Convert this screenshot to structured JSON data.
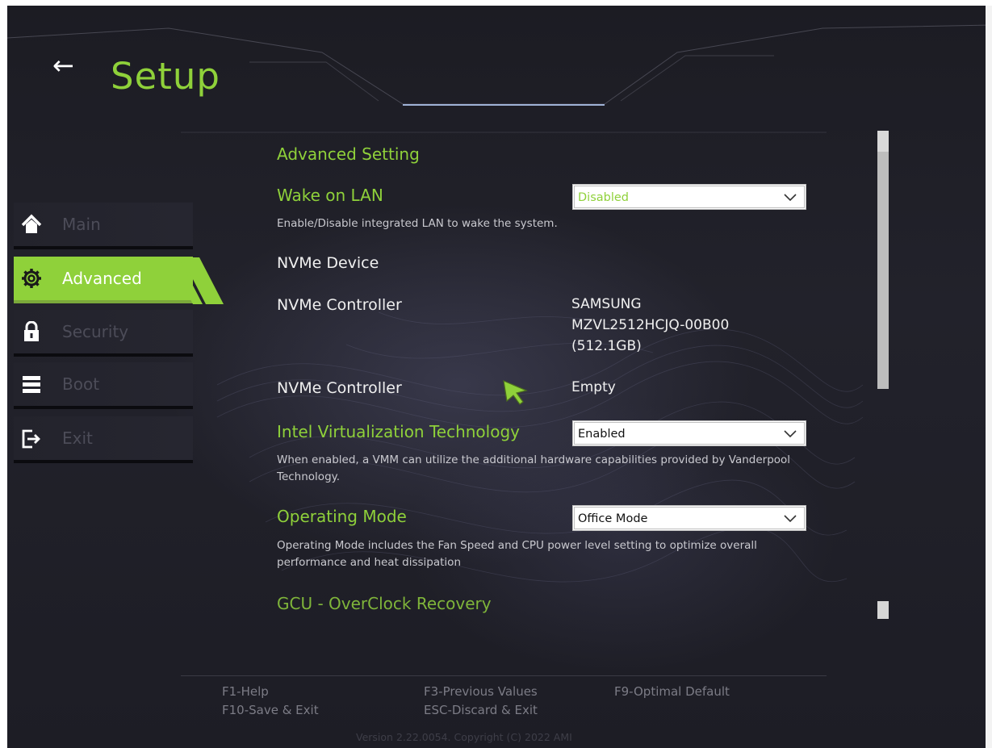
{
  "header": {
    "back_icon": "←",
    "title": "Setup"
  },
  "sidebar": {
    "items": [
      {
        "label": "Main",
        "icon": "home-icon",
        "active": false
      },
      {
        "label": "Advanced",
        "icon": "gear-icon",
        "active": true
      },
      {
        "label": "Security",
        "icon": "lock-icon",
        "active": false
      },
      {
        "label": "Boot",
        "icon": "boot-list-icon",
        "active": false
      },
      {
        "label": "Exit",
        "icon": "exit-icon",
        "active": false
      }
    ]
  },
  "content": {
    "section_title": "Advanced Setting",
    "wake_on_lan": {
      "label": "Wake on LAN",
      "value": "Disabled",
      "description": "Enable/Disable integrated LAN to wake the system."
    },
    "nvme_device_label": "NVMe Device",
    "nvme_controller_1": {
      "label": "NVMe Controller",
      "value_line1": "SAMSUNG",
      "value_line2": "MZVL2512HCJQ-00B00",
      "value_line3": "(512.1GB)"
    },
    "nvme_controller_2": {
      "label": "NVMe Controller",
      "value": "Empty"
    },
    "intel_vt": {
      "label": "Intel Virtualization Technology",
      "value": "Enabled",
      "description": "When enabled, a VMM can utilize the additional hardware capabilities provided by Vanderpool Technology."
    },
    "operating_mode": {
      "label": "Operating Mode",
      "value": "Office Mode",
      "description": "Operating Mode includes the Fan Speed and CPU power level setting to optimize overall performance and heat dissipation"
    },
    "gcu_link": "GCU - OverClock Recovery"
  },
  "footer": {
    "keys": {
      "f1": "F1-Help",
      "f10": "F10-Save & Exit",
      "f3": "F3-Previous Values",
      "esc": "ESC-Discard & Exit",
      "f9": "F9-Optimal Default"
    },
    "version": "Version 2.22.0054. Copyright (C) 2022 AMI"
  },
  "colors": {
    "accent_green": "#8fd13a",
    "background": "#1f1f27",
    "inactive_text": "#4c4c58"
  }
}
